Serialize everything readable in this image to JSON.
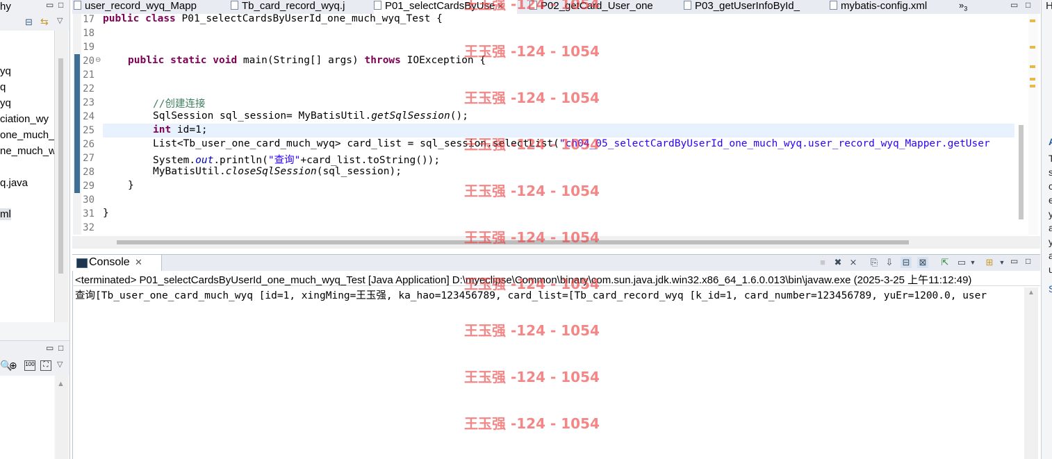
{
  "left_panel": {
    "header_label": "hy",
    "tree_items": [
      "yq",
      "q",
      "yq",
      "ciation_wy",
      "one_much_",
      "ne_much_w",
      "q.java",
      "ml"
    ]
  },
  "editor": {
    "tabs": [
      {
        "label": "user_record_wyq_Mapp"
      },
      {
        "label": "Tb_card_record_wyq.j"
      },
      {
        "label": "P01_selectCardsByUse",
        "active": true
      },
      {
        "label": "P02_getCard_User_one"
      },
      {
        "label": "P03_getUserInfoById_"
      },
      {
        "label": "mybatis-config.xml"
      }
    ],
    "overflow_count": "3",
    "line_numbers": [
      "17",
      "18",
      "19",
      "20",
      "21",
      "22",
      "23",
      "24",
      "25",
      "26",
      "27",
      "28",
      "29",
      "30",
      "31",
      "32"
    ],
    "code": {
      "l17_kw1": "public",
      "l17_kw2": "class",
      "l17_rest": " P01_selectCardsByUserId_one_much_wyq_Test {",
      "l20_kw1": "public",
      "l20_kw2": "static",
      "l20_kw3": "void",
      "l20_mid": " main(String[] args) ",
      "l20_kw4": "throws",
      "l20_rest": " IOException {",
      "l23_comment": "//创建连接",
      "l24_a": "SqlSession sql_session= MyBatisUtil.",
      "l24_b": "getSqlSession",
      "l24_c": "();",
      "l25_kw": "int",
      "l25_rest": " id=1;",
      "l26_a": "List<Tb_user_one_card_much_wyq> card_list = sql_session.selectList(",
      "l26_str": "\"ch04_05_selectCardByUserId_one_much_wyq.user_record_wyq_Mapper.getUser",
      "l27_a": "System.",
      "l27_b": "out",
      "l27_c": ".println(",
      "l27_str": "\"查询\"",
      "l27_d": "+card_list.toString());",
      "l28_a": "MyBatisUtil.",
      "l28_b": "closeSqlSession",
      "l28_c": "(sql_session);",
      "l29": "}",
      "l31": "}"
    }
  },
  "console": {
    "tab_label": "Console",
    "status_line": "<terminated> P01_selectCardsByUserId_one_much_wyq_Test [Java Application] D:\\myeclipse\\Common\\binary\\com.sun.java.jdk.win32.x86_64_1.6.0.013\\bin\\javaw.exe (2025-3-25 上午11:12:49)",
    "output_line": "查询[Tb_user_one_card_much_wyq [id=1, xingMing=王玉强, ka_hao=123456789, card_list=[Tb_card_record_wyq [k_id=1, card_number=123456789, yuEr=1200.0, user"
  },
  "watermark": {
    "text": "王玉强 -124 - 1054"
  },
  "right_panel": {
    "letters": [
      "H",
      "A",
      "T",
      "s",
      "c",
      "e",
      "y",
      "a",
      "y",
      "a",
      "u",
      "S"
    ]
  },
  "colors": {
    "keyword": "#7f0055",
    "comment": "#3f7f5f",
    "string": "#2a00ff",
    "watermark": "#eb3c3c"
  }
}
